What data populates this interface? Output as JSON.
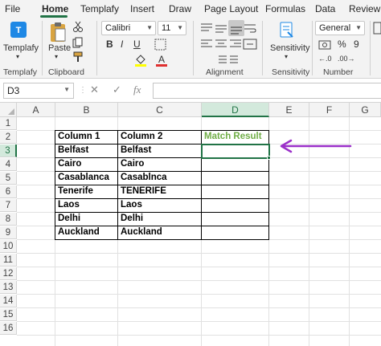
{
  "ribbon_tabs": [
    "File",
    "Home",
    "Templafy",
    "Insert",
    "Draw",
    "Page Layout",
    "Formulas",
    "Data",
    "Review"
  ],
  "active_tab": "Home",
  "groups": {
    "templafy": "Templafy",
    "clipboard": "Clipboard",
    "paste": "Paste",
    "alignment": "Alignment",
    "sensitivity": "Sensitivity",
    "sensitivity_button": "Sensitivity",
    "number": "Number"
  },
  "font": {
    "name": "Calibri",
    "size": "11"
  },
  "number_format": "General",
  "name_box": "D3",
  "fx_label": "fx",
  "columns": [
    "A",
    "B",
    "C",
    "D",
    "E",
    "F",
    "G"
  ],
  "rows": [
    "1",
    "2",
    "3",
    "4",
    "5",
    "6",
    "7",
    "8",
    "9",
    "10",
    "11",
    "12",
    "13",
    "14",
    "15",
    "16"
  ],
  "table": {
    "headers": [
      "Column 1",
      "Column 2",
      "Match Result"
    ],
    "rows": [
      [
        "Belfast",
        "Belfast",
        ""
      ],
      [
        "Cairo",
        "Cairo",
        ""
      ],
      [
        "Casablanca",
        "Casablnca",
        ""
      ],
      [
        "Tenerife",
        "TENERIFE",
        ""
      ],
      [
        "Laos",
        "Laos",
        ""
      ],
      [
        "Delhi",
        "Delhi",
        ""
      ],
      [
        "Auckland",
        "Auckland",
        ""
      ]
    ]
  },
  "colors": {
    "excel_green": "#217346",
    "match_header": "#70ad47",
    "arrow": "#9b30c9"
  }
}
